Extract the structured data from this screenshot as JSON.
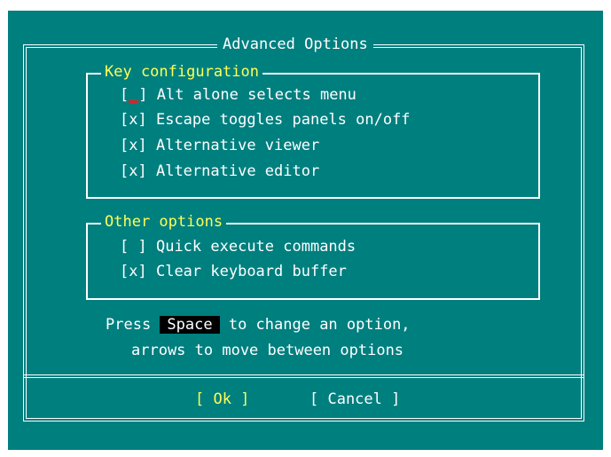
{
  "dialog": {
    "title": "Advanced Options"
  },
  "groups": {
    "key_config": {
      "label": "Key configuration",
      "options": [
        {
          "mark": "[ ]",
          "label": "Alt alone selects menu",
          "checked": false
        },
        {
          "mark": "[x]",
          "label": "Escape toggles panels on/off",
          "checked": true
        },
        {
          "mark": "[x]",
          "label": "Alternative viewer",
          "checked": true
        },
        {
          "mark": "[x]",
          "label": "Alternative editor",
          "checked": true
        }
      ]
    },
    "other": {
      "label": "Other options",
      "options": [
        {
          "mark": "[ ]",
          "label": "Quick execute commands",
          "checked": false
        },
        {
          "mark": "[x]",
          "label": "Clear keyboard buffer",
          "checked": true
        }
      ]
    }
  },
  "help": {
    "line1_prefix": "Press ",
    "key": "Space",
    "line1_suffix": " to change an option,",
    "line2": "arrows to move between options"
  },
  "buttons": {
    "ok": "[ Ok ]",
    "cancel": "[ Cancel ]"
  },
  "colors": {
    "background": "#007f7f",
    "text": "#ffffff",
    "highlight": "#ffff55",
    "cursor": "#e02020",
    "key_bg": "#000000"
  }
}
